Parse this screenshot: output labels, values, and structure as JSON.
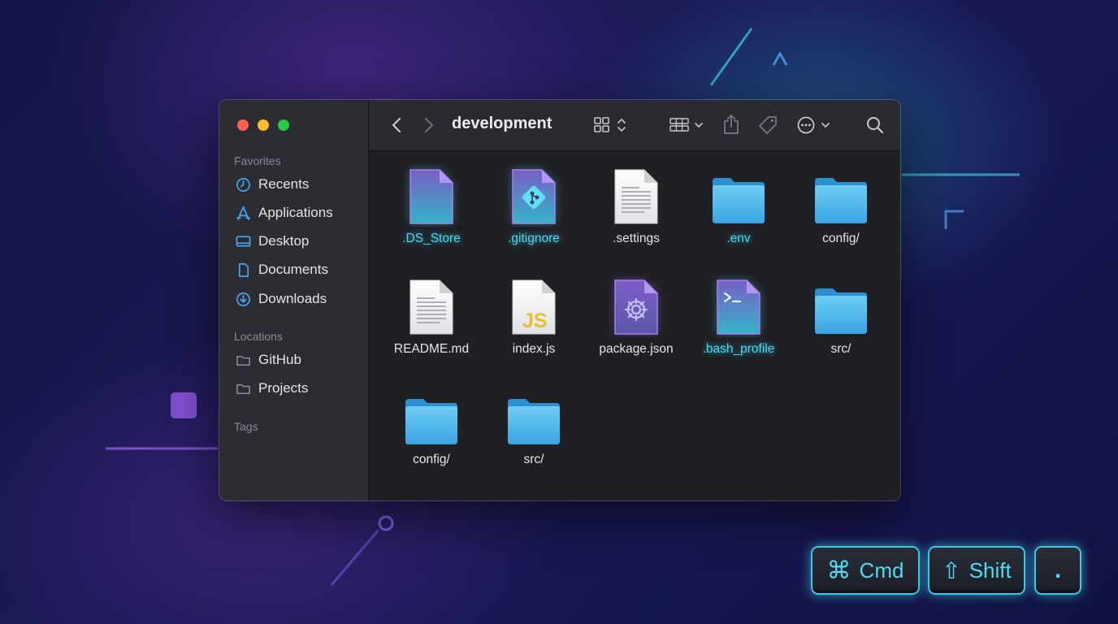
{
  "window": {
    "title": "development"
  },
  "sidebar": {
    "sections": {
      "favorites": "Favorites",
      "locations": "Locations",
      "tags": "Tags"
    },
    "favorites": [
      {
        "label": "Recents",
        "icon": "clock-icon"
      },
      {
        "label": "Applications",
        "icon": "applications-icon"
      },
      {
        "label": "Desktop",
        "icon": "desktop-icon"
      },
      {
        "label": "Documents",
        "icon": "document-icon"
      },
      {
        "label": "Downloads",
        "icon": "download-icon"
      }
    ],
    "locations": [
      {
        "label": "GitHub",
        "icon": "folder-icon"
      },
      {
        "label": "Projects",
        "icon": "folder-icon"
      }
    ]
  },
  "files": [
    {
      "name": ".DS_Store",
      "kind": "hidden-file",
      "hidden": true
    },
    {
      "name": ".gitignore",
      "kind": "git-file",
      "hidden": true
    },
    {
      "name": ".settings",
      "kind": "text-file",
      "hidden": false
    },
    {
      "name": ".env",
      "kind": "folder",
      "hidden": true
    },
    {
      "name": "config/",
      "kind": "folder",
      "hidden": false
    },
    {
      "name": "README.md",
      "kind": "text-file",
      "hidden": false
    },
    {
      "name": "index.js",
      "kind": "js-file",
      "hidden": false
    },
    {
      "name": "package.json",
      "kind": "gear-file",
      "hidden": false
    },
    {
      "name": ".bash_profile",
      "kind": "terminal-file",
      "hidden": true
    },
    {
      "name": "src/",
      "kind": "folder",
      "hidden": false
    },
    {
      "name": "config/",
      "kind": "folder",
      "hidden": false
    },
    {
      "name": "src/",
      "kind": "folder",
      "hidden": false
    }
  ],
  "js_badge": "JS",
  "shortcut": {
    "cmd_symbol": "⌘",
    "cmd": "Cmd",
    "shift_symbol": "⇧",
    "shift": "Shift",
    "period": "."
  },
  "colors": {
    "accent_cyan": "#4fd6ec",
    "accent_purple": "#a46ee8",
    "folder_blue": "#5bc0f0"
  }
}
